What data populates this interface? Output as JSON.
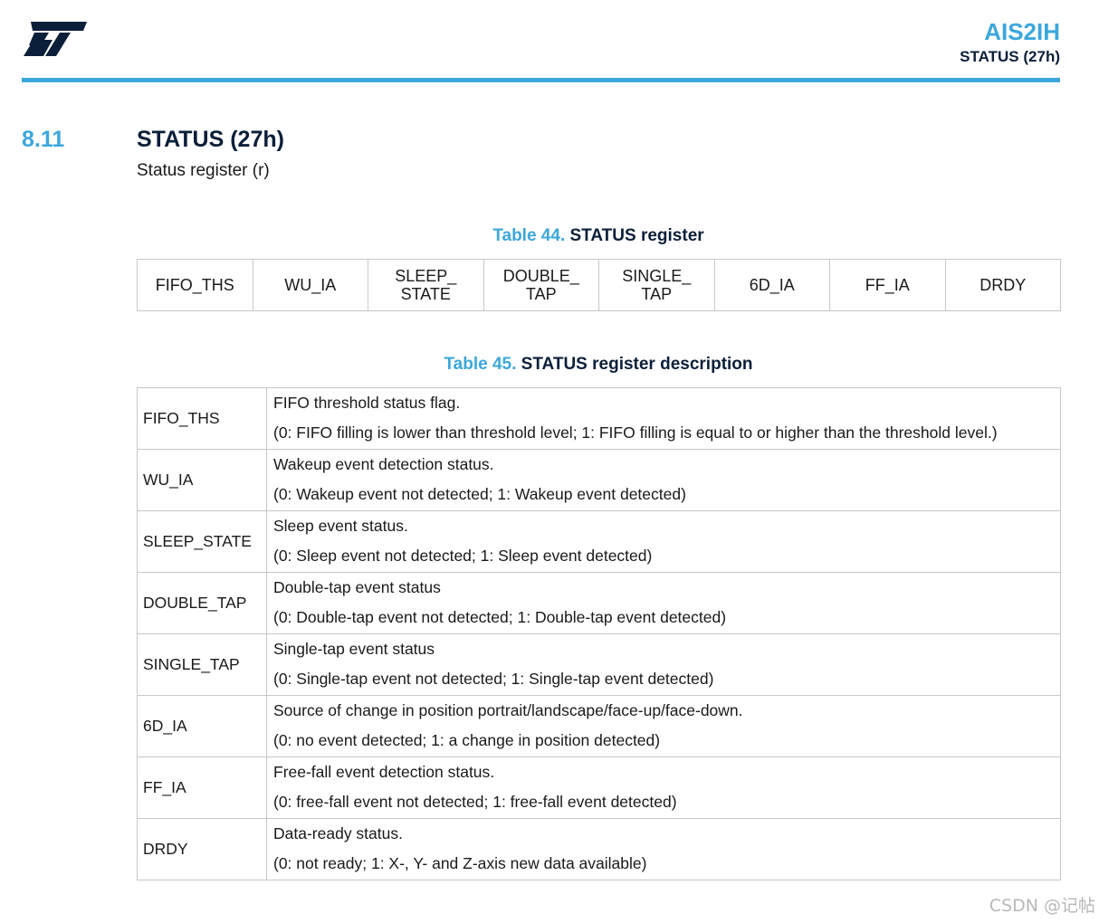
{
  "header": {
    "logo": "st-logo",
    "doc_title": "AIS2IH",
    "doc_subtitle": "STATUS (27h)",
    "accent_color": "#3ca7dd"
  },
  "section": {
    "number": "8.11",
    "title": "STATUS (27h)",
    "description": "Status register (r)"
  },
  "table44": {
    "number": "Table 44.",
    "title": "STATUS register",
    "bits": [
      "FIFO_THS",
      "WU_IA",
      "SLEEP_\nSTATE",
      "DOUBLE_\nTAP",
      "SINGLE_\nTAP",
      "6D_IA",
      "FF_IA",
      "DRDY"
    ]
  },
  "table45": {
    "number": "Table 45.",
    "title": "STATUS register description",
    "rows": [
      {
        "name": "FIFO_THS",
        "line1": "FIFO threshold status flag.",
        "line2": "(0: FIFO filling is lower than threshold level; 1: FIFO filling is equal to or higher than the threshold level.)"
      },
      {
        "name": "WU_IA",
        "line1": "Wakeup event detection status.",
        "line2": "(0: Wakeup event not detected; 1: Wakeup event detected)"
      },
      {
        "name": "SLEEP_STATE",
        "line1": "Sleep event status.",
        "line2": "(0: Sleep event not detected; 1: Sleep event detected)"
      },
      {
        "name": "DOUBLE_TAP",
        "line1": "Double-tap event status",
        "line2": "(0: Double-tap event not detected; 1: Double-tap event detected)"
      },
      {
        "name": "SINGLE_TAP",
        "line1": "Single-tap event status",
        "line2": "(0: Single-tap event not detected; 1: Single-tap event detected)"
      },
      {
        "name": "6D_IA",
        "line1": "Source of change in position portrait/landscape/face-up/face-down.",
        "line2": "(0: no event detected; 1: a change in position detected)"
      },
      {
        "name": "FF_IA",
        "line1": "Free-fall event detection status.",
        "line2": "(0: free-fall event not detected; 1: free-fall event detected)"
      },
      {
        "name": "DRDY",
        "line1": "Data-ready status.",
        "line2": "(0: not ready; 1: X-, Y- and Z-axis new data available)"
      }
    ]
  },
  "watermark": "CSDN @记帖"
}
